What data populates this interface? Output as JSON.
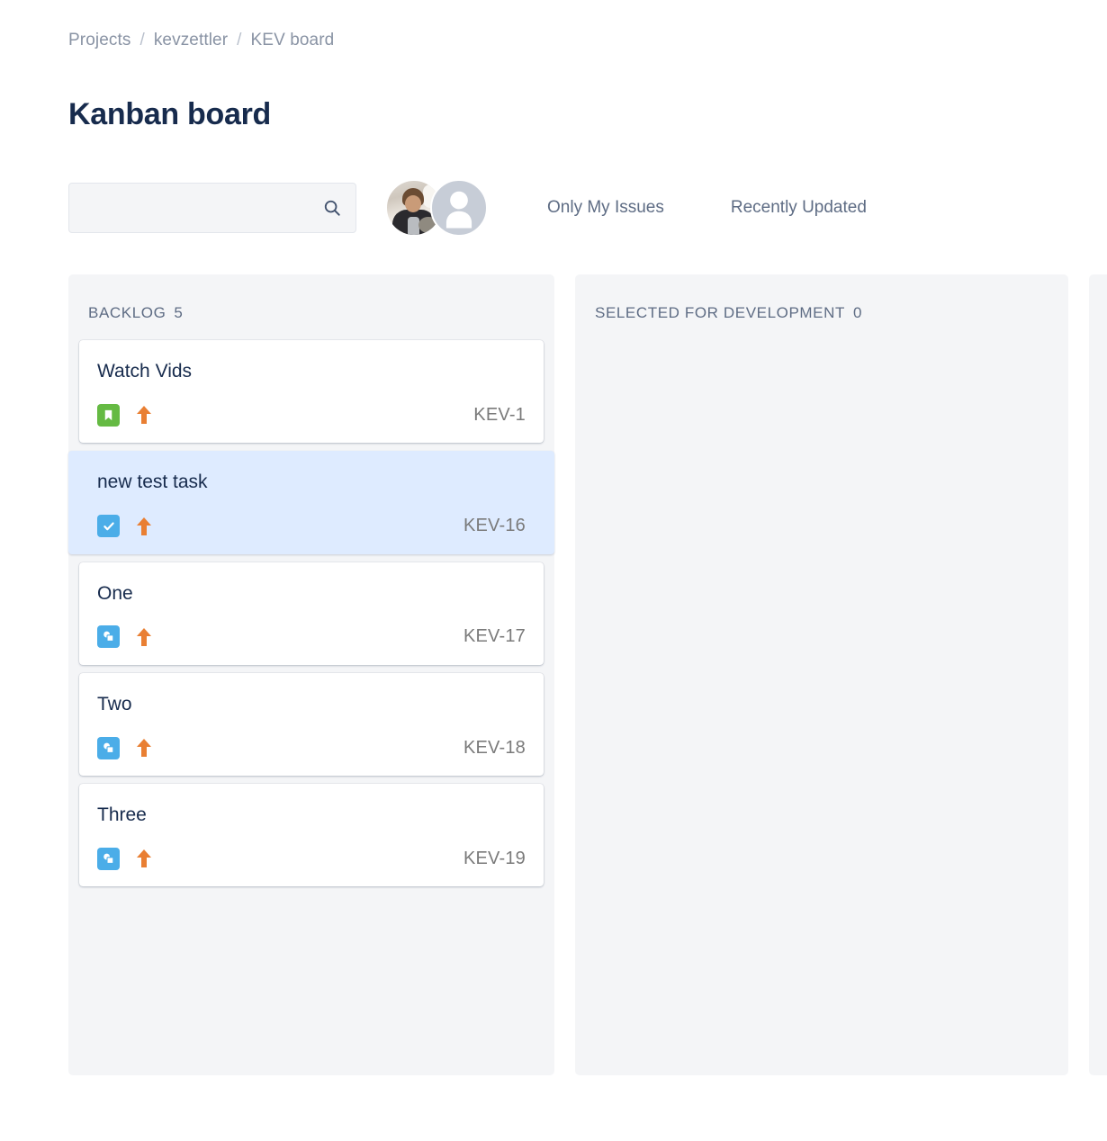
{
  "breadcrumb": {
    "items": [
      "Projects",
      "kevzettler",
      "KEV board"
    ],
    "separator": "/"
  },
  "page_title": "Kanban board",
  "toolbar": {
    "search": {
      "value": "",
      "placeholder": "",
      "icon": "search-icon"
    },
    "avatars": [
      {
        "type": "photo",
        "name": "user-avatar-photo"
      },
      {
        "type": "default",
        "name": "user-avatar-default"
      }
    ],
    "filters": [
      {
        "label": "Only My Issues",
        "active": false
      },
      {
        "label": "Recently Updated",
        "active": false
      }
    ]
  },
  "board": {
    "columns": [
      {
        "title": "BACKLOG",
        "count": "5",
        "cards": [
          {
            "title": "Watch Vids",
            "key": "KEV-1",
            "type": "story",
            "type_icon": "story-icon",
            "priority": "high",
            "priority_icon": "arrow-up-icon",
            "selected": false
          },
          {
            "title": "new test task",
            "key": "KEV-16",
            "type": "task",
            "type_icon": "task-check-icon",
            "priority": "high",
            "priority_icon": "arrow-up-icon",
            "selected": true
          },
          {
            "title": "One",
            "key": "KEV-17",
            "type": "subtask",
            "type_icon": "subtask-icon",
            "priority": "high",
            "priority_icon": "arrow-up-icon",
            "selected": false
          },
          {
            "title": "Two",
            "key": "KEV-18",
            "type": "subtask",
            "type_icon": "subtask-icon",
            "priority": "high",
            "priority_icon": "arrow-up-icon",
            "selected": false
          },
          {
            "title": "Three",
            "key": "KEV-19",
            "type": "subtask",
            "type_icon": "subtask-icon",
            "priority": "high",
            "priority_icon": "arrow-up-icon",
            "selected": false
          }
        ]
      },
      {
        "title": "SELECTED FOR DEVELOPMENT",
        "count": "0",
        "cards": []
      },
      {
        "title": "",
        "count": "",
        "cards": []
      }
    ]
  },
  "colors": {
    "title": "#172b4d",
    "muted": "#5e6c84",
    "breadcrumb": "#8993a4",
    "column_bg": "#f4f5f7",
    "card_bg": "#ffffff",
    "card_selected_bg": "#deebff",
    "story_green": "#65ba43",
    "task_blue": "#4bade8",
    "priority_orange": "#e97f33",
    "key_gray": "#7a7a7a"
  }
}
